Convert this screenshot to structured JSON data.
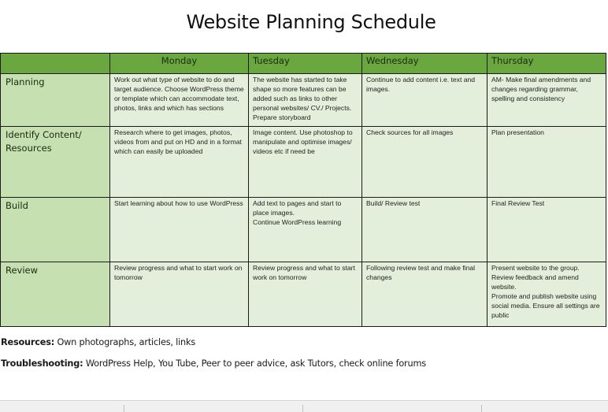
{
  "document": {
    "title": "Website Planning Schedule"
  },
  "table": {
    "corner": "",
    "columns": [
      "Monday",
      "Tuesday",
      "Wednesday",
      "Thursday"
    ],
    "rows": [
      {
        "label": "Planning",
        "cells": [
          "Work out what type of website to do and target audience. Choose WordPress theme or template which can accommodate text, photos, links and which has sections",
          "The website has started to take shape so more features can be added such as links to other personal websites/ CV./ Projects. Prepare storyboard",
          "Continue to add content i.e. text and images.",
          "AM- Make final amendments and changes regarding grammar, spelling and consistency"
        ]
      },
      {
        "label": "Identify Content/ Resources",
        "cells": [
          "Research where to get images, photos, videos from and put on HD and in a format which can easily be uploaded",
          "Image content. Use photoshop to manipulate and optimise images/ videos etc if need be",
          "Check sources for all images",
          "Plan presentation"
        ]
      },
      {
        "label": "Build",
        "cells": [
          "Start learning about how to use WordPress",
          "Add text to pages and start to place images.\nContinue WordPress learning",
          "Build/ Review test",
          "Final Review Test"
        ]
      },
      {
        "label": "Review",
        "cells": [
          "Review progress and what to start work on tomorrow",
          "Review progress and what to start work on tomorrow",
          "Following review test and make final changes",
          "Present website to the group.\nReview feedback and amend website.\nPromote and publish website using social media. Ensure all settings are public"
        ]
      }
    ]
  },
  "notes": {
    "resources_label": "Resources:",
    "resources_text": " Own photographs, articles, links",
    "troubleshooting_label": "Troubleshooting:",
    "troubleshooting_text": " WordPress Help, You Tube, Peer to peer advice, ask Tutors, check online forums"
  },
  "colors": {
    "header_green": "#6aa73f",
    "row_label_green": "#c7e0b1",
    "cell_green": "#e4efdb"
  }
}
